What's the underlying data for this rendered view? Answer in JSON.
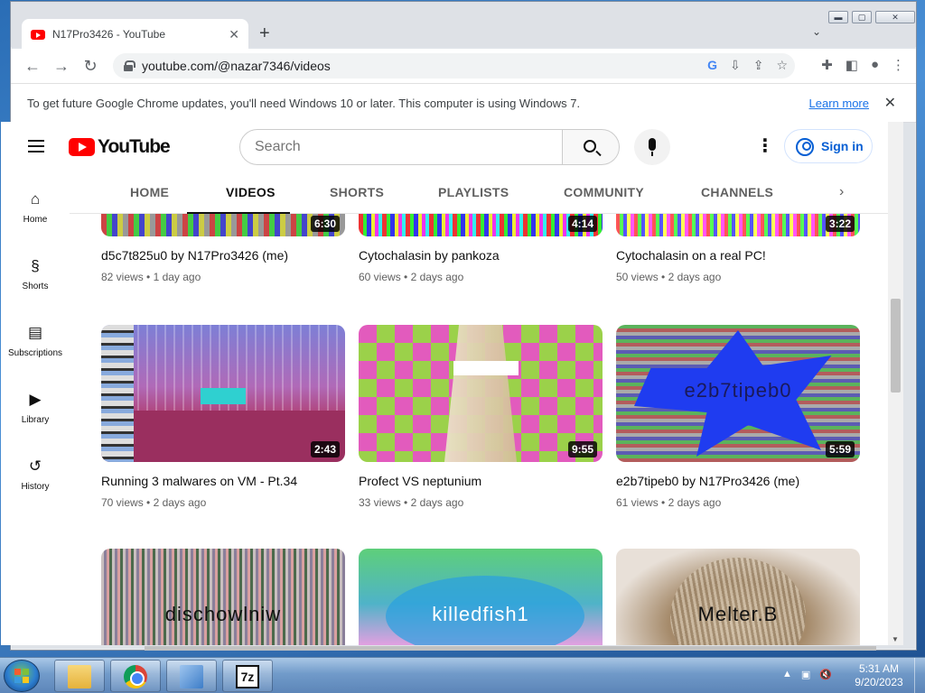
{
  "browser": {
    "tab_title": "N17Pro3426 - YouTube",
    "tab_close": "✕",
    "new_tab": "+",
    "url": "youtube.com/@nazar7346/videos",
    "window_controls": {
      "minimize": "▬",
      "maximize": "▢",
      "close": "✕"
    },
    "infobar": {
      "message": "To get future Google Chrome updates, you'll need Windows 10 or later. This computer is using Windows 7.",
      "learn_more": "Learn more",
      "close": "✕"
    }
  },
  "youtube": {
    "logo_text": "YouTube",
    "search_placeholder": "Search",
    "sign_in": "Sign in",
    "guide": [
      {
        "label": "Home",
        "icon": "home-icon",
        "glyph": "⌂"
      },
      {
        "label": "Shorts",
        "icon": "shorts-icon",
        "glyph": "§"
      },
      {
        "label": "Subscriptions",
        "icon": "subscriptions-icon",
        "glyph": "▤"
      },
      {
        "label": "Library",
        "icon": "library-icon",
        "glyph": "▶"
      },
      {
        "label": "History",
        "icon": "history-icon",
        "glyph": "↺"
      }
    ],
    "channel_tabs": [
      "HOME",
      "VIDEOS",
      "SHORTS",
      "PLAYLISTS",
      "COMMUNITY",
      "CHANNELS"
    ],
    "active_tab": "VIDEOS",
    "videos": [
      {
        "title": "d5c7t825u0 by N17Pro3426 (me)",
        "views": "82 views",
        "age": "1 day ago",
        "duration": "6:30",
        "thumb_text": ""
      },
      {
        "title": "Cytochalasin by pankoza",
        "views": "60 views",
        "age": "2 days ago",
        "duration": "4:14",
        "thumb_text": ""
      },
      {
        "title": "Cytochalasin on a real PC!",
        "views": "50 views",
        "age": "2 days ago",
        "duration": "3:22",
        "thumb_text": ""
      },
      {
        "title": "Running 3 malwares on VM - Pt.34",
        "views": "70 views",
        "age": "2 days ago",
        "duration": "2:43",
        "thumb_text": ""
      },
      {
        "title": "Profect VS neptunium",
        "views": "33 views",
        "age": "2 days ago",
        "duration": "9:55",
        "thumb_text": ""
      },
      {
        "title": "e2b7tipeb0 by N17Pro3426 (me)",
        "views": "61 views",
        "age": "2 days ago",
        "duration": "5:59",
        "thumb_text": "e2b7tipeb0"
      },
      {
        "title": "",
        "views": "",
        "age": "",
        "duration": "",
        "thumb_text": "dischowlniw"
      },
      {
        "title": "",
        "views": "",
        "age": "",
        "duration": "",
        "thumb_text": "killedfish1"
      },
      {
        "title": "",
        "views": "",
        "age": "",
        "duration": "",
        "thumb_text": "Melter.B"
      }
    ]
  },
  "taskbar": {
    "time": "5:31 AM",
    "date": "9/20/2023",
    "apps": [
      "file-explorer-icon",
      "chrome-icon",
      "control-panel-icon",
      "7zip-icon"
    ],
    "app_7z_label": "7z"
  },
  "colors": {
    "youtube_red": "#ff0000",
    "link_blue": "#065fd4",
    "chrome_blue": "#1a73e8"
  }
}
